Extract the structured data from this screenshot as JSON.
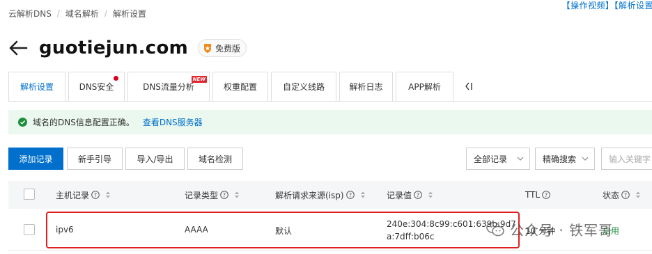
{
  "breadcrumb": {
    "items": [
      "云解析DNS",
      "域名解析",
      "解析设置"
    ],
    "separator": "/"
  },
  "top_links": {
    "text": "【操作视频】【解析设置"
  },
  "header": {
    "domain": "guotiejun.com",
    "edition": "免费版"
  },
  "tabs": [
    {
      "label": "解析设置",
      "active": true
    },
    {
      "label": "DNS安全",
      "has_dot": true
    },
    {
      "label": "DNS流量分析",
      "badge": "NEW"
    },
    {
      "label": "权重配置"
    },
    {
      "label": "自定义线路"
    },
    {
      "label": "解析日志"
    },
    {
      "label": "APP解析"
    }
  ],
  "alert": {
    "message": "域名的DNS信息配置正确。",
    "link": "查看DNS服务器"
  },
  "toolbar": {
    "add_record": "添加记录",
    "guide": "新手引导",
    "import_export": "导入/导出",
    "domain_check": "域名检测",
    "filter_select": "全部记录",
    "search_mode": "精确搜索",
    "search_placeholder": "输入关键字"
  },
  "table": {
    "columns": [
      "主机记录",
      "记录类型",
      "解析请求来源(isp)",
      "记录值",
      "TTL",
      "状态"
    ],
    "rows": [
      {
        "host": "ipv6",
        "type": "AAAA",
        "isp": "默认",
        "value": "240e:304:8c99:c601:639b:9d7a:7dff:b06c",
        "ttl": "10 分钟",
        "status": "启用"
      }
    ]
  },
  "watermark": {
    "text": "公众号 · 铁军哥"
  },
  "colors": {
    "brand": "#0070cc",
    "alert_bg": "#ebf8f0",
    "highlight": "#e02020",
    "badge_orange": "#f08c1e"
  }
}
